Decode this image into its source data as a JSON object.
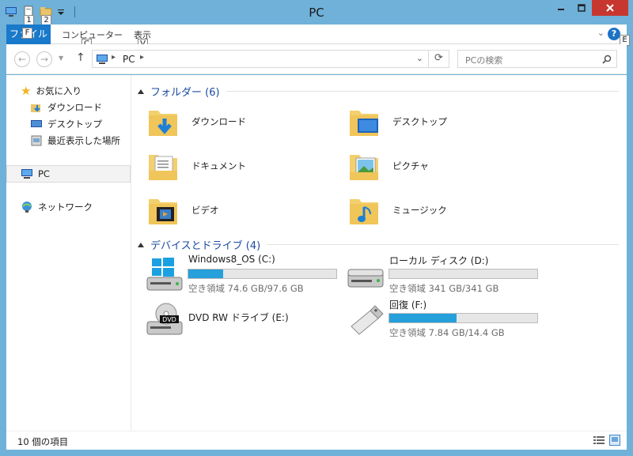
{
  "window": {
    "title": "PC"
  },
  "keytips": {
    "qat1": "1",
    "qat2": "2",
    "file": "F",
    "computer": "C",
    "view": "V",
    "help": "E"
  },
  "ribbon": {
    "file_label": "ファイル",
    "tabs": [
      "コンピューター",
      "表示"
    ]
  },
  "address": {
    "crumb": "PC"
  },
  "search": {
    "placeholder": "PCの検索"
  },
  "nav": {
    "favorites": "お気に入り",
    "fav_items": [
      "ダウンロード",
      "デスクトップ",
      "最近表示した場所"
    ],
    "pc": "PC",
    "network": "ネットワーク"
  },
  "folders": {
    "header": "フォルダー (6)",
    "items": [
      "ダウンロード",
      "デスクトップ",
      "ドキュメント",
      "ピクチャ",
      "ビデオ",
      "ミュージック"
    ]
  },
  "drives": {
    "header": "デバイスとドライブ (4)",
    "items": [
      {
        "name": "Windows8_OS (C:)",
        "info": "空き領域 74.6 GB/97.6 GB",
        "used_fraction": 0.236
      },
      {
        "name": "ローカル ディスク (D:)",
        "info": "空き領域 341 GB/341 GB",
        "used_fraction": 0.0
      },
      {
        "name": "DVD RW ドライブ (E:)"
      },
      {
        "name": "回復 (F:)",
        "info": "空き領域 7.84 GB/14.4 GB",
        "used_fraction": 0.456
      }
    ]
  },
  "status": {
    "count": "10 個の項目"
  },
  "colors": {
    "frame": "#6fb1d8",
    "accent": "#1979ca",
    "close": "#c7372f",
    "bar": "#26a0da"
  }
}
